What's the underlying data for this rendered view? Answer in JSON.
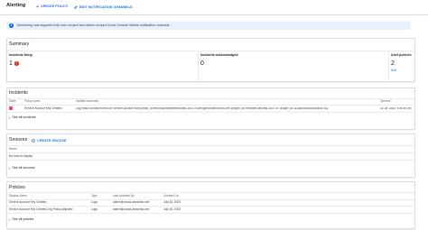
{
  "header": {
    "title": "Alerting",
    "create_policy": "CREATE POLICY",
    "edit_channels": "EDIT NOTIFICATION CHANNELS"
  },
  "banner": {
    "text": "Monitoring now supports both user scoped and device scoped Cloud Console Mobile notification channels"
  },
  "summary": {
    "title": "Summary",
    "cards": [
      {
        "label": "Incidents firing",
        "value": "1"
      },
      {
        "label": "Incidents acknowledged",
        "value": "0"
      },
      {
        "label": "Alert policies",
        "value": "2",
        "link": "Edit"
      }
    ]
  },
  "incidents": {
    "title": "Incidents",
    "columns": [
      "State",
      "Policy name",
      "Incident summary",
      "Opened"
    ],
    "rows": [
      {
        "policy": "Service Account Key Created",
        "summary": "Log match condition fired for Service Account with {email_id=test-sa@redwhitesecurity-363719.iam.gserviceaccount.com, project_id=redwhite-security-363719, unique_id=113685384563689458783}",
        "opened": "Jul 28, 2023, 5:30:48 PM"
      }
    ],
    "see_all": "See all incidents"
  },
  "snoozes": {
    "title": "Snoozes",
    "create": "CREATE SNOOZE",
    "columns": [
      "Name"
    ],
    "empty": "No rows to display",
    "see_all": "See all snoozes"
  },
  "policies": {
    "title": "Policies",
    "columns": [
      "Display Name",
      "Type",
      "Last Modified By",
      "Created On"
    ],
    "rows": [
      {
        "name": "Service Account Key Created",
        "type": "Logs",
        "modified_by": "admin@cosas.ahostnat.com",
        "created": "July 28, 2023"
      },
      {
        "name": "Service Account Key Created-Org Policy Adjusted",
        "type": "Logs",
        "modified_by": "admin@cosas.ahostnat.com",
        "created": "July 28, 2023"
      }
    ],
    "see_all": "See all policies"
  }
}
